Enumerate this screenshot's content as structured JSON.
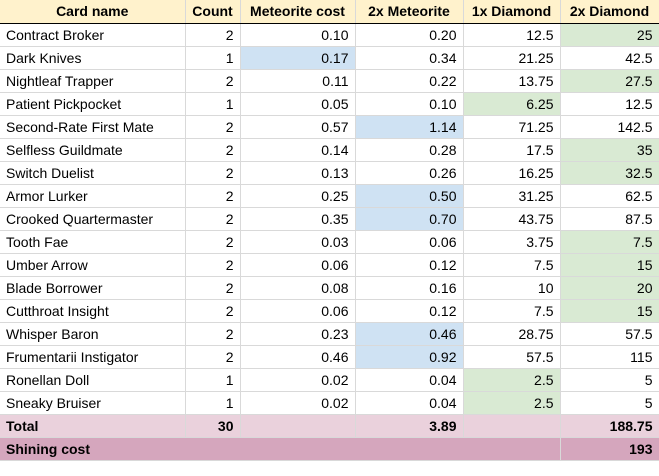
{
  "columns": [
    "Card name",
    "Count",
    "Meteorite cost",
    "2x Meteorite",
    "1x Diamond",
    "2x Diamond"
  ],
  "highlight_colors": {
    "blue": "#cfe2f3",
    "green": "#d9ead3",
    "total": "#ead1dc",
    "shining": "#d5a6bd",
    "header": "#fff2cc"
  },
  "rows": [
    {
      "name": "Contract Broker",
      "count": "2",
      "meteorite": "0.10",
      "meteorite2x": "0.20",
      "diamond1x": "12.5",
      "diamond2x": "25"
    },
    {
      "name": "Dark Knives",
      "count": "1",
      "meteorite": "0.17",
      "meteorite2x": "0.34",
      "diamond1x": "21.25",
      "diamond2x": "42.5"
    },
    {
      "name": "Nightleaf Trapper",
      "count": "2",
      "meteorite": "0.11",
      "meteorite2x": "0.22",
      "diamond1x": "13.75",
      "diamond2x": "27.5"
    },
    {
      "name": "Patient Pickpocket",
      "count": "1",
      "meteorite": "0.05",
      "meteorite2x": "0.10",
      "diamond1x": "6.25",
      "diamond2x": "12.5"
    },
    {
      "name": "Second-Rate First Mate",
      "count": "2",
      "meteorite": "0.57",
      "meteorite2x": "1.14",
      "diamond1x": "71.25",
      "diamond2x": "142.5"
    },
    {
      "name": "Selfless Guildmate",
      "count": "2",
      "meteorite": "0.14",
      "meteorite2x": "0.28",
      "diamond1x": "17.5",
      "diamond2x": "35"
    },
    {
      "name": "Switch Duelist",
      "count": "2",
      "meteorite": "0.13",
      "meteorite2x": "0.26",
      "diamond1x": "16.25",
      "diamond2x": "32.5"
    },
    {
      "name": "Armor Lurker",
      "count": "2",
      "meteorite": "0.25",
      "meteorite2x": "0.50",
      "diamond1x": "31.25",
      "diamond2x": "62.5"
    },
    {
      "name": "Crooked Quartermaster",
      "count": "2",
      "meteorite": "0.35",
      "meteorite2x": "0.70",
      "diamond1x": "43.75",
      "diamond2x": "87.5"
    },
    {
      "name": "Tooth Fae",
      "count": "2",
      "meteorite": "0.03",
      "meteorite2x": "0.06",
      "diamond1x": "3.75",
      "diamond2x": "7.5"
    },
    {
      "name": "Umber Arrow",
      "count": "2",
      "meteorite": "0.06",
      "meteorite2x": "0.12",
      "diamond1x": "7.5",
      "diamond2x": "15"
    },
    {
      "name": "Blade Borrower",
      "count": "2",
      "meteorite": "0.08",
      "meteorite2x": "0.16",
      "diamond1x": "10",
      "diamond2x": "20"
    },
    {
      "name": "Cutthroat Insight",
      "count": "2",
      "meteorite": "0.06",
      "meteorite2x": "0.12",
      "diamond1x": "7.5",
      "diamond2x": "15"
    },
    {
      "name": "Whisper Baron",
      "count": "2",
      "meteorite": "0.23",
      "meteorite2x": "0.46",
      "diamond1x": "28.75",
      "diamond2x": "57.5"
    },
    {
      "name": "Frumentarii Instigator",
      "count": "2",
      "meteorite": "0.46",
      "meteorite2x": "0.92",
      "diamond1x": "57.5",
      "diamond2x": "115"
    },
    {
      "name": "Ronellan Doll",
      "count": "1",
      "meteorite": "0.02",
      "meteorite2x": "0.04",
      "diamond1x": "2.5",
      "diamond2x": "5"
    },
    {
      "name": "Sneaky Bruiser",
      "count": "1",
      "meteorite": "0.02",
      "meteorite2x": "0.04",
      "diamond1x": "2.5",
      "diamond2x": "5"
    }
  ],
  "total": {
    "label": "Total",
    "count": "30",
    "meteorite2x": "3.89",
    "diamond2x": "188.75"
  },
  "shining": {
    "label": "Shining cost",
    "value": "193"
  }
}
